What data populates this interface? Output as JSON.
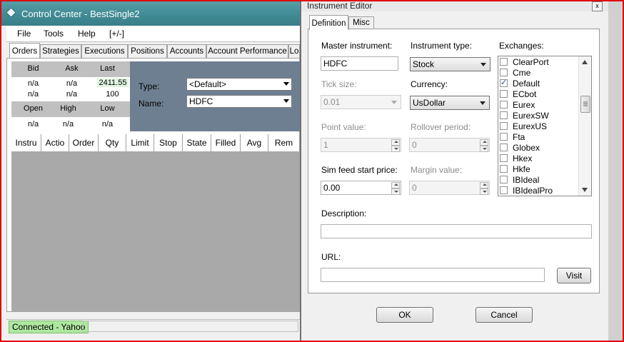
{
  "control_center": {
    "title": "Control Center - BestSingle2",
    "menu": [
      "File",
      "Tools",
      "Help",
      "[+/-]"
    ],
    "tabs": [
      "Orders",
      "Strategies",
      "Executions",
      "Positions",
      "Accounts",
      "Account Performance",
      "Lo"
    ],
    "quote": {
      "bid_label": "Bid",
      "ask_label": "Ask",
      "last_label": "Last",
      "bid1": "n/a",
      "ask1": "n/a",
      "last1": "2411.55",
      "bid2": "n/a",
      "ask2": "n/a",
      "last2": "100",
      "open_label": "Open",
      "high_label": "High",
      "low_label": "Low",
      "open": "n/a",
      "high": "n/a",
      "low": "n/a"
    },
    "type_label": "Type:",
    "type_value": "<Default>",
    "name_label": "Name:",
    "name_value": "HDFC",
    "grid_columns": [
      "Instru",
      "Actio",
      "Order",
      "Qty",
      "Limit",
      "Stop",
      "State",
      "Filled",
      "Avg",
      "Rem"
    ],
    "status": "Connected - Yahoo"
  },
  "instrument_editor": {
    "title": "Instrument Editor",
    "close": "x",
    "tabs": [
      "Definition",
      "Misc"
    ],
    "master_label": "Master instrument:",
    "master_value": "HDFC",
    "type_label": "Instrument type:",
    "type_value": "Stock",
    "exchanges_label": "Exchanges:",
    "tick_label": "Tick size:",
    "tick_value": "0.01",
    "currency_label": "Currency:",
    "currency_value": "UsDollar",
    "point_label": "Point value:",
    "point_value": "1",
    "rollover_label": "Rollover period:",
    "rollover_value": "0",
    "simfeed_label": "Sim feed start price:",
    "simfeed_value": "0.00",
    "margin_label": "Margin value:",
    "margin_value": "0",
    "description_label": "Description:",
    "description_value": "",
    "url_label": "URL:",
    "url_value": "",
    "visit_label": "Visit",
    "ok_label": "OK",
    "cancel_label": "Cancel",
    "exchanges": [
      {
        "name": "ClearPort",
        "checked": false
      },
      {
        "name": "Cme",
        "checked": false
      },
      {
        "name": "Default",
        "checked": true
      },
      {
        "name": "ECbot",
        "checked": false
      },
      {
        "name": "Eurex",
        "checked": false
      },
      {
        "name": "EurexSW",
        "checked": false
      },
      {
        "name": "EurexUS",
        "checked": false
      },
      {
        "name": "Fta",
        "checked": false
      },
      {
        "name": "Globex",
        "checked": false
      },
      {
        "name": "Hkex",
        "checked": false
      },
      {
        "name": "Hkfe",
        "checked": false
      },
      {
        "name": "IBIdeal",
        "checked": false
      },
      {
        "name": "IBIdealPro",
        "checked": false
      }
    ]
  },
  "colors": {
    "titlebar": "#3f8a94",
    "panel": "#6f7f92",
    "status_bg": "#aee8a0",
    "frame": "#e00000"
  }
}
